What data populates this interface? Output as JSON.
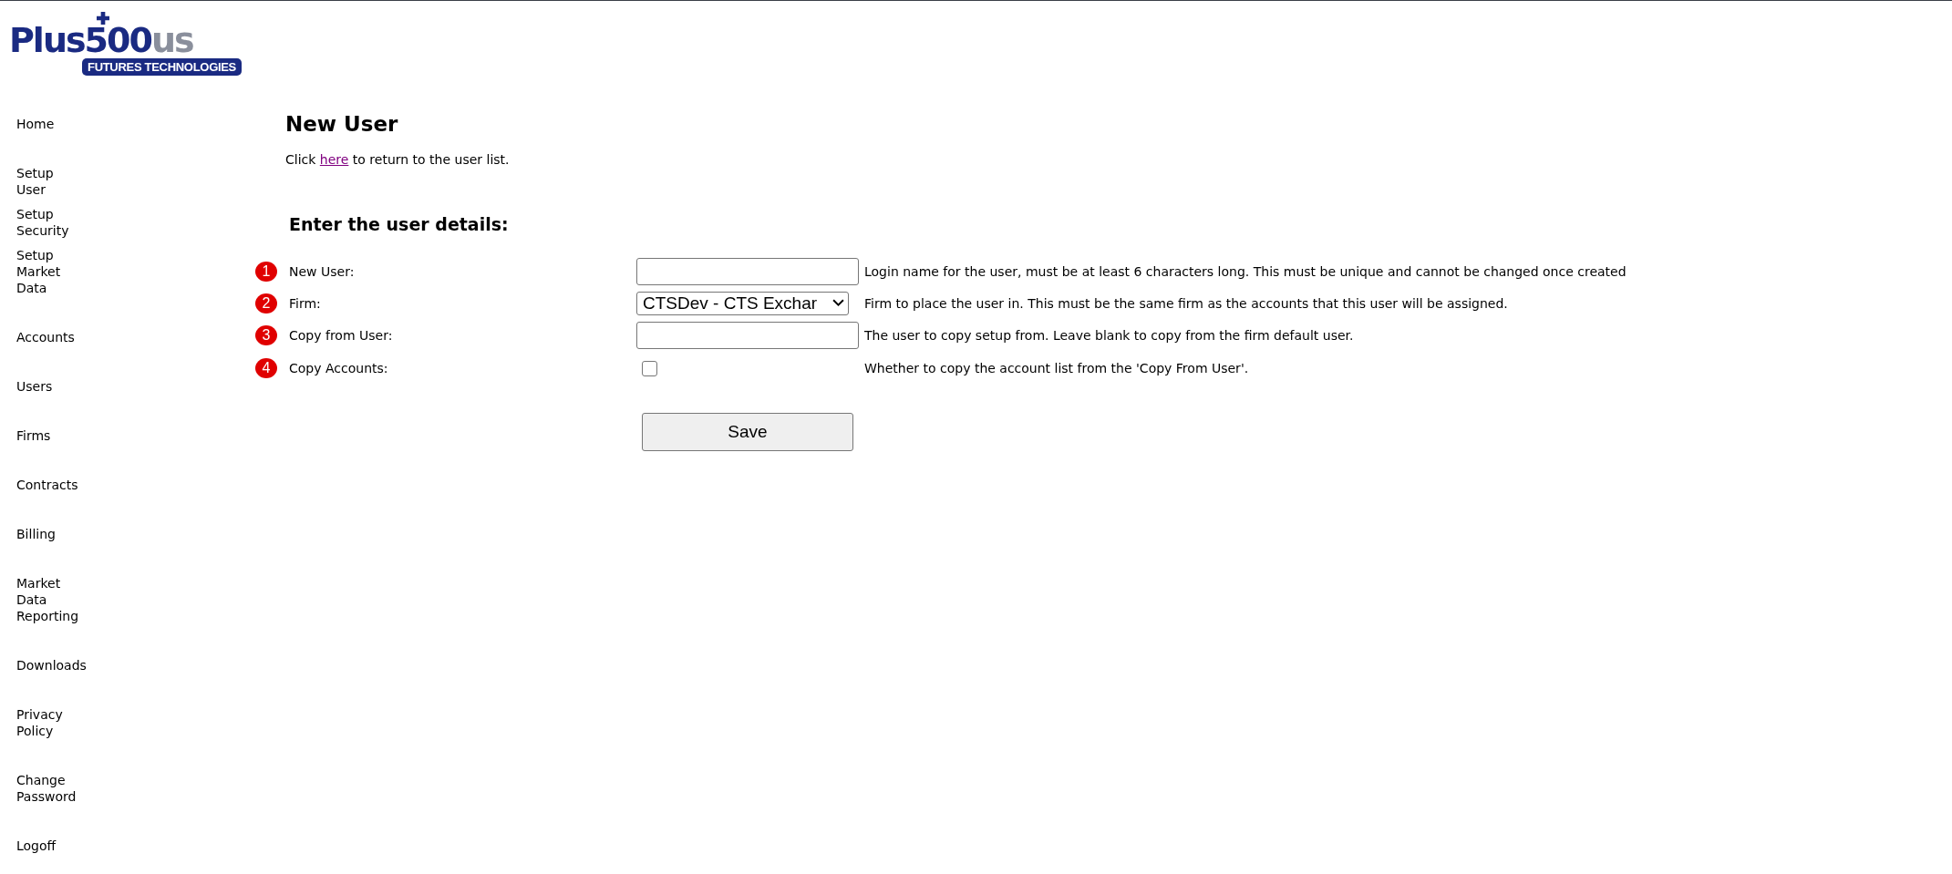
{
  "logo": {
    "brand": "Plus500",
    "suffix": "us",
    "tagline": "FUTURES TECHNOLOGIES"
  },
  "sidebar": {
    "sections": [
      {
        "items": [
          {
            "label": "Home"
          }
        ]
      },
      {
        "items": [
          {
            "label": "Setup User"
          },
          {
            "label": "Setup Security"
          },
          {
            "label": "Setup Market Data"
          }
        ]
      },
      {
        "items": [
          {
            "label": "Accounts"
          }
        ]
      },
      {
        "items": [
          {
            "label": "Users"
          }
        ]
      },
      {
        "items": [
          {
            "label": "Firms"
          }
        ]
      },
      {
        "items": [
          {
            "label": "Contracts"
          }
        ]
      },
      {
        "items": [
          {
            "label": "Billing"
          }
        ]
      },
      {
        "items": [
          {
            "label": "Market Data Reporting"
          }
        ]
      },
      {
        "items": [
          {
            "label": "Downloads"
          }
        ]
      },
      {
        "items": [
          {
            "label": "Privacy Policy"
          }
        ]
      },
      {
        "items": [
          {
            "label": "Change Password"
          }
        ]
      },
      {
        "items": [
          {
            "label": "Logoff"
          }
        ]
      }
    ]
  },
  "page": {
    "title": "New User",
    "intro": {
      "before": "Click ",
      "link": "here",
      "after": " to return to the user list."
    }
  },
  "form": {
    "heading": "Enter the user details:",
    "fields": [
      {
        "number": "1",
        "label": "New User:",
        "kind": "text",
        "help": "Login name for the user, must be at least 6 characters long. This must be unique and cannot be changed once created"
      },
      {
        "number": "2",
        "label": "Firm:",
        "kind": "select",
        "value": "CTSDev - CTS Exchar",
        "help": "Firm to place the user in. This must be the same firm as the accounts that this user will be assigned."
      },
      {
        "number": "3",
        "label": "Copy from User:",
        "kind": "text",
        "help": "The user to copy setup from. Leave blank to copy from the firm default user."
      },
      {
        "number": "4",
        "label": "Copy Accounts:",
        "kind": "checkbox",
        "checked": false,
        "help": "Whether to copy the account list from the 'Copy From User'."
      }
    ],
    "submit": "Save"
  }
}
